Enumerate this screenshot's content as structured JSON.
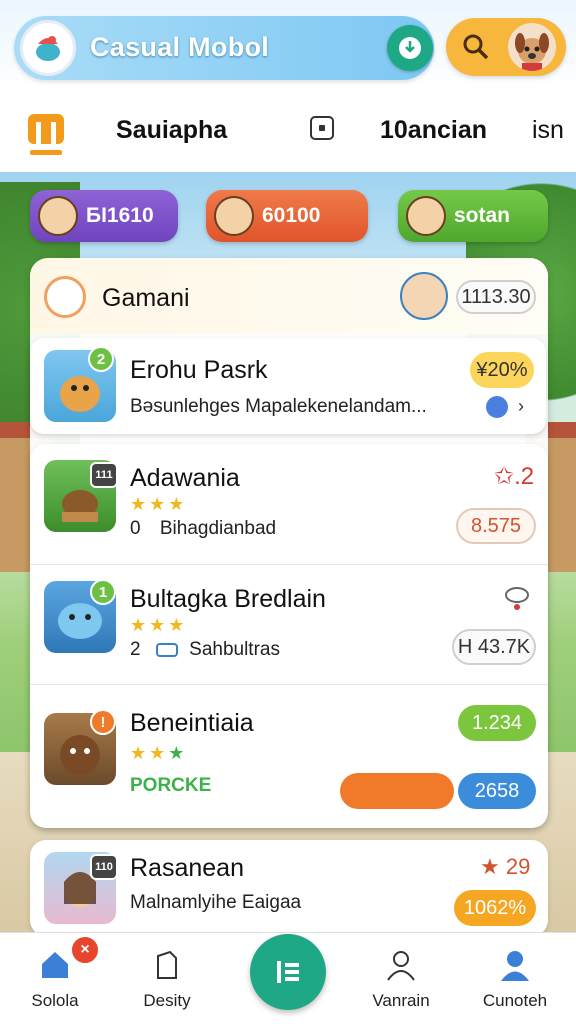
{
  "header": {
    "app_title": "Casual Mobol",
    "logo_icon": "chef-hat-logo-icon",
    "download_icon": "download-icon",
    "search_icon": "search-icon",
    "avatar_icon": "dog-avatar-icon"
  },
  "tabs": {
    "logo_icon": "m-logo-icon",
    "items": [
      {
        "label": "Sauiapha"
      },
      {
        "label": "10ancian"
      },
      {
        "label": "isn"
      }
    ]
  },
  "chips": [
    {
      "value": "БI1610",
      "color": "#7a50c9"
    },
    {
      "value": "60100",
      "color": "#e8663a"
    },
    {
      "value": "sotan",
      "color": "#5db53a"
    }
  ],
  "panel": {
    "title": "Gamani",
    "count": "1113.30",
    "featured": {
      "title": "Erohu Pasrk",
      "subtitle": "Bəsunlehges Mapalekenelandam...",
      "badge": "2",
      "discount": "¥20%"
    },
    "games": [
      {
        "title": "Adawania",
        "stars": "★★★",
        "rank": "0",
        "category": "Bihagdianbad",
        "rating": "✩.2",
        "price": "8.575",
        "badge": "111"
      },
      {
        "title": "Bultagka Bredlain",
        "stars": "★★★",
        "rank": "2",
        "category": "Sahbultras",
        "price": "H 43.7K",
        "badge": "1"
      },
      {
        "title": "Beneintiaia",
        "stars": "★★★",
        "tag": "PORCKE",
        "price": "1.234",
        "secondary": "2658",
        "badge": "!"
      }
    ],
    "last": {
      "title": "Rasanean",
      "subtitle": "Malnamlyihe Eaigaa",
      "rating": "★ 29",
      "price": "1062%",
      "badge": "110"
    }
  },
  "nav": {
    "items": [
      {
        "label": "Sololа",
        "icon": "home-icon",
        "badge": "×"
      },
      {
        "label": "Desity",
        "icon": "cube-icon"
      },
      {
        "label": "Vanrain",
        "icon": "user-outline-icon"
      },
      {
        "label": "Cunoteh",
        "icon": "profile-icon"
      }
    ],
    "fab_icon": "list-icon"
  },
  "colors": {
    "accent_green": "#1fa886",
    "accent_orange": "#f6b73c"
  }
}
